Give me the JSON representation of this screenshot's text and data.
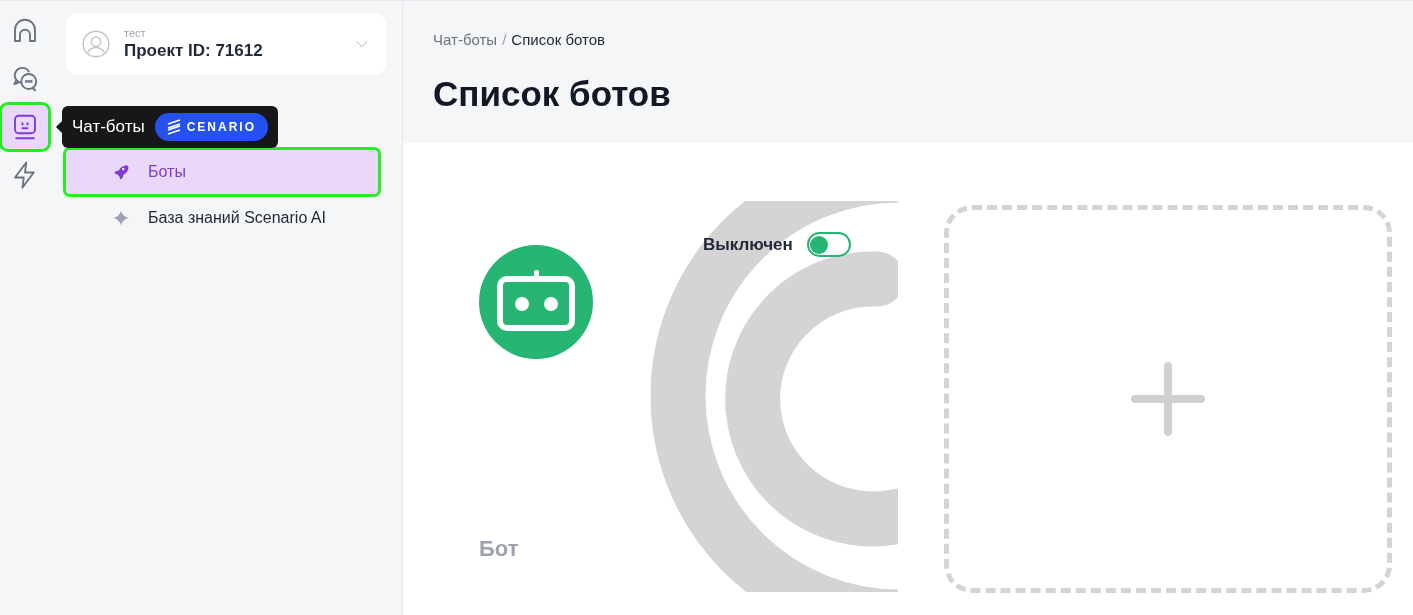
{
  "rail": [
    {
      "kind": "home",
      "selected": false,
      "highlighted": false
    },
    {
      "kind": "chat",
      "selected": false,
      "highlighted": false
    },
    {
      "kind": "bot",
      "selected": true,
      "highlighted": true
    },
    {
      "kind": "bolt",
      "selected": false,
      "highlighted": false
    }
  ],
  "tooltip": {
    "label": "Чат-боты",
    "badge": "CENARIO"
  },
  "project": {
    "caption": "тест",
    "title": "Проект ID: 71612"
  },
  "nav": [
    {
      "kind": "rocket",
      "label": "Боты",
      "selected": true,
      "highlighted": true
    },
    {
      "kind": "diamond",
      "label": "База знаний Scenario AI",
      "selected": false,
      "highlighted": false
    }
  ],
  "breadcrumb": [
    {
      "label": "Чат-боты",
      "current": false
    },
    {
      "label": "Список ботов",
      "current": true
    }
  ],
  "breadcrumb_separator": "/",
  "title": "Список ботов",
  "bots": [
    {
      "name": "Бот",
      "status": "Выключен",
      "on": false
    }
  ]
}
